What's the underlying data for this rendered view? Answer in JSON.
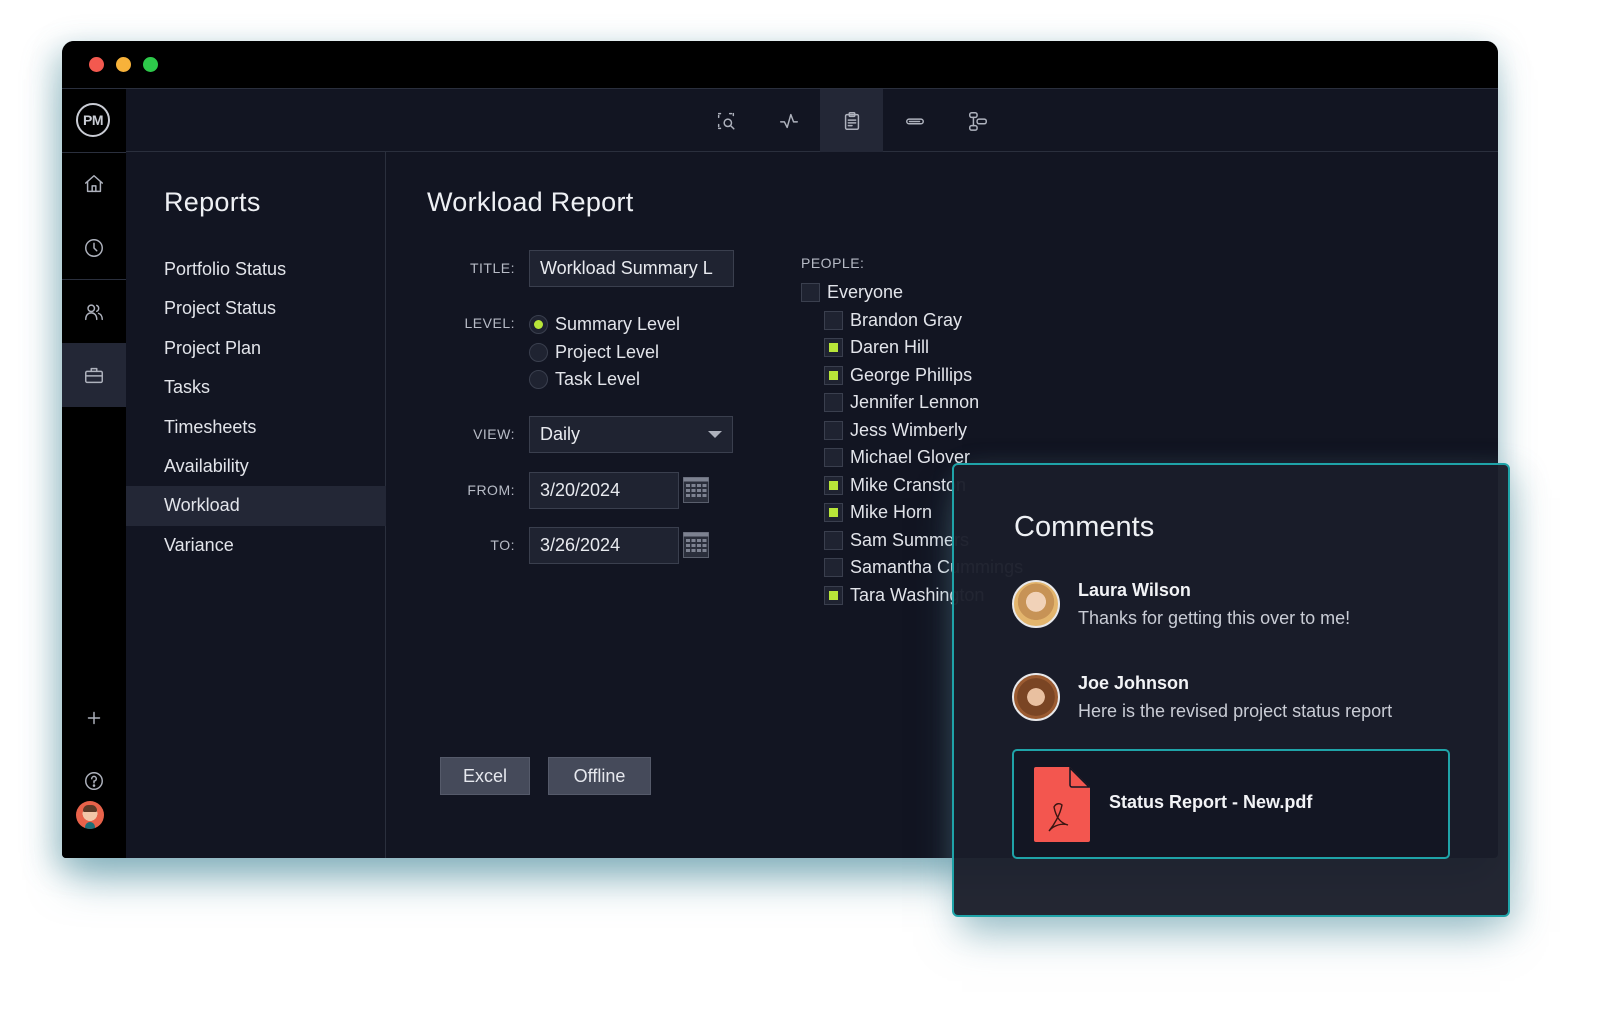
{
  "app": {
    "logo_text": "PM",
    "window_controls": [
      "close",
      "minimize",
      "maximize"
    ]
  },
  "rail": {
    "items": [
      {
        "name": "home",
        "icon": "home-icon",
        "active": false
      },
      {
        "name": "recent",
        "icon": "clock-icon",
        "active": false
      },
      {
        "name": "people",
        "icon": "users-icon",
        "active": false
      },
      {
        "name": "portfolio",
        "icon": "briefcase-icon",
        "active": true
      }
    ],
    "bottom": [
      {
        "name": "add",
        "icon": "plus-icon"
      },
      {
        "name": "help",
        "icon": "help-icon"
      },
      {
        "name": "profile",
        "icon": "user-avatar"
      }
    ]
  },
  "toolbar": {
    "tools": [
      {
        "name": "search-view",
        "icon": "zoom-select-icon",
        "active": false
      },
      {
        "name": "dashboard",
        "icon": "pulse-icon",
        "active": false
      },
      {
        "name": "reports",
        "icon": "clipboard-icon",
        "active": true
      },
      {
        "name": "timeline",
        "icon": "bar-icon",
        "active": false
      },
      {
        "name": "workflow",
        "icon": "hierarchy-icon",
        "active": false
      }
    ]
  },
  "reports": {
    "title": "Reports",
    "items": [
      {
        "label": "Portfolio Status"
      },
      {
        "label": "Project Status"
      },
      {
        "label": "Project Plan"
      },
      {
        "label": "Tasks"
      },
      {
        "label": "Timesheets"
      },
      {
        "label": "Availability"
      },
      {
        "label": "Workload",
        "active": true
      },
      {
        "label": "Variance"
      }
    ]
  },
  "form": {
    "heading": "Workload Report",
    "title_label": "TITLE:",
    "title_value": "Workload Summary L",
    "level_label": "LEVEL:",
    "levels": [
      {
        "label": "Summary Level",
        "selected": true
      },
      {
        "label": "Project Level",
        "selected": false
      },
      {
        "label": "Task Level",
        "selected": false
      }
    ],
    "view_label": "VIEW:",
    "view_value": "Daily",
    "from_label": "FROM:",
    "from_value": "3/20/2024",
    "to_label": "TO:",
    "to_value": "3/26/2024",
    "buttons": {
      "excel": "Excel",
      "offline": "Offline"
    }
  },
  "people": {
    "label": "PEOPLE:",
    "everyone": {
      "label": "Everyone",
      "checked": false
    },
    "list": [
      {
        "name": "Brandon Gray",
        "checked": false
      },
      {
        "name": "Daren Hill",
        "checked": true
      },
      {
        "name": "George Phillips",
        "checked": true
      },
      {
        "name": "Jennifer Lennon",
        "checked": false
      },
      {
        "name": "Jess Wimberly",
        "checked": false
      },
      {
        "name": "Michael Glover",
        "checked": false
      },
      {
        "name": "Mike Cranston",
        "checked": true
      },
      {
        "name": "Mike Horn",
        "checked": true
      },
      {
        "name": "Sam Summers",
        "checked": false
      },
      {
        "name": "Samantha Cummings",
        "checked": false
      },
      {
        "name": "Tara Washington",
        "checked": true
      }
    ]
  },
  "comments": {
    "title": "Comments",
    "items": [
      {
        "author": "Laura Wilson",
        "text": "Thanks for getting this over to me!"
      },
      {
        "author": "Joe Johnson",
        "text": "Here is the revised project status report"
      }
    ],
    "attachment": {
      "name": "Status Report - New.pdf",
      "icon": "pdf-file-icon"
    }
  },
  "colors": {
    "accent_check": "#b8e639",
    "accent_border": "#1fa3a8",
    "pdf_red": "#f3564f",
    "window_bg": "#121522",
    "rail_bg": "#000000"
  }
}
